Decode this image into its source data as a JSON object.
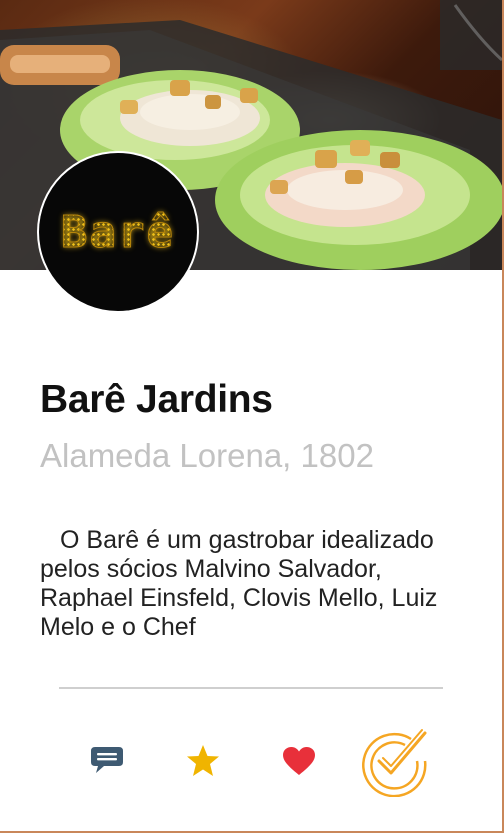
{
  "restaurant": {
    "logo_text": "Barê",
    "name": "Barê Jardins",
    "address": "Alameda Lorena, 1802",
    "description": "O Barê é um gastrobar idealizado pelos sócios Malvino Salvador, Raphael Einsfeld, Clovis Mello, Luiz Melo e o Chef"
  },
  "hero": {
    "image_subject": "lettuce-wrap-appetizer"
  },
  "actions": [
    {
      "icon": "comment-icon",
      "color": "#3e5a72"
    },
    {
      "icon": "star-icon",
      "color": "#f0b400"
    },
    {
      "icon": "heart-icon",
      "color": "#e8303a"
    },
    {
      "icon": "check-in-icon",
      "color": "#f5a623"
    }
  ],
  "colors": {
    "accent": "#f5a623",
    "border": "#c9875a"
  }
}
